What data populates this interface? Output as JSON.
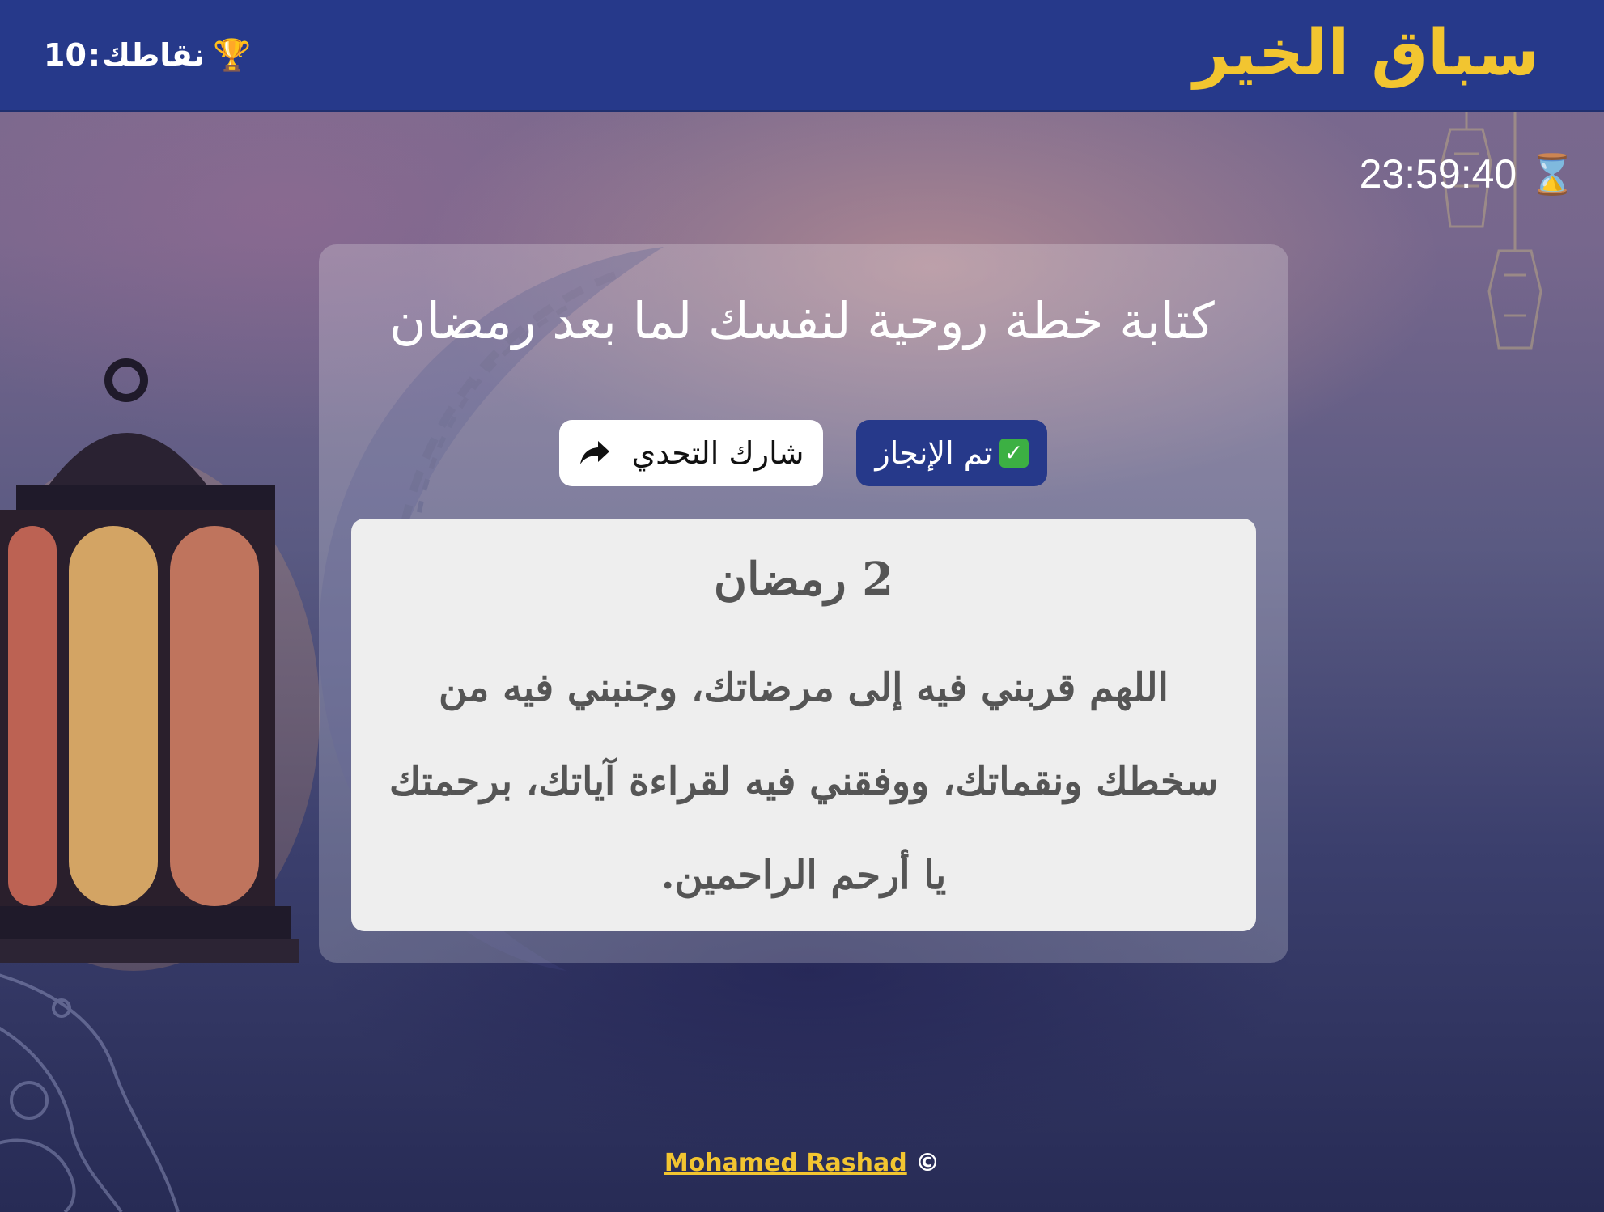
{
  "header": {
    "logo_text": "سباق الخير",
    "points_label": "نقاطك",
    "points_value": "10",
    "trophy_icon": "trophy-icon"
  },
  "timer": {
    "value": "23:59:40",
    "icon": "hourglass-icon"
  },
  "task": {
    "title": "كتابة خطة روحية لنفسك لما بعد رمضان",
    "done_label": "تم الإنجاز",
    "share_label": "شارك التحدي"
  },
  "dua": {
    "day": "2 رمضان",
    "text": "اللهم قربني فيه إلى مرضاتك، وجنبني فيه من سخطك ونقماتك، ووفقني فيه لقراءة آياتك، برحمتك يا أرحم الراحمين."
  },
  "footer": {
    "copyright": "©",
    "author": "Mohamed Rashad"
  },
  "colors": {
    "header_bg": "#26398a",
    "accent_yellow": "#f2c530",
    "done_button_bg": "#26398a",
    "share_button_bg": "#ffffff",
    "dua_box_bg": "#eeeeee"
  }
}
